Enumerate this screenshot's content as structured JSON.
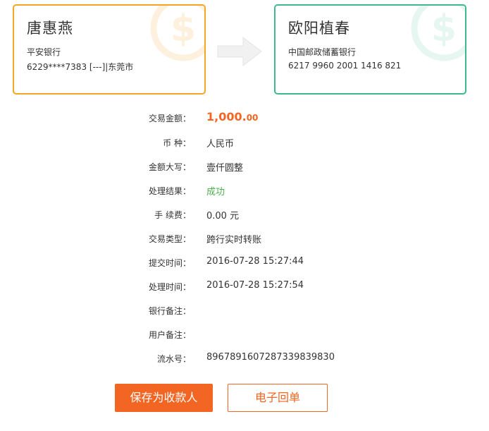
{
  "payer": {
    "name": "唐惠燕",
    "bank": "平安银行",
    "account": "6229****7383 [---]|东莞市",
    "icon": "dollar-coin-icon",
    "color": "#f5a623"
  },
  "payee": {
    "name": "欧阳植春",
    "bank": "中国邮政储蓄银行",
    "account": "6217 9960 2001 1416 821",
    "icon": "dollar-coin-icon",
    "color": "#3fb88f"
  },
  "transfer_arrow_icon": "right-arrow-icon",
  "details": {
    "amount_label": "交易金额：",
    "amount_main": "1,000.",
    "amount_cents": "00",
    "currency_label": "币 种：",
    "currency_value": "人民币",
    "amount_words_label": "金额大写：",
    "amount_words_value": "壹仟圆整",
    "status_label": "处理结果：",
    "status_value": "成功",
    "fee_label": "手 续费：",
    "fee_value": "0.00 元",
    "type_label": "交易类型：",
    "type_value": "跨行实时转账",
    "submit_time_label": "提交时间：",
    "submit_time_value": "2016-07-28 15:27:44",
    "process_time_label": "处理时间：",
    "process_time_value": "2016-07-28 15:27:54",
    "bank_note_label": "银行备注：",
    "bank_note_value": "",
    "user_note_label": "用户备注：",
    "user_note_value": "",
    "serial_label": "流水号：",
    "serial_value": "896789160728733983983​0"
  },
  "buttons": {
    "save_payee": "保存为收款人",
    "e_receipt": "电子回单"
  },
  "colors": {
    "accent": "#f26522",
    "success": "#4caf50"
  }
}
